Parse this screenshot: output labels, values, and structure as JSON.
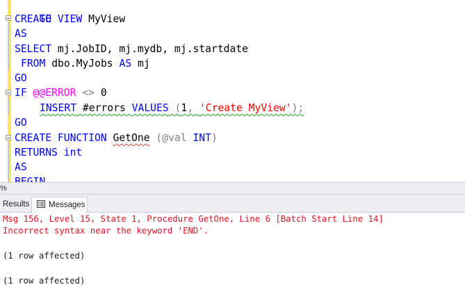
{
  "editor": {
    "lines": [
      {
        "t1": "GO"
      },
      {
        "t1": "CREATE VIEW",
        "t2": " MyView"
      },
      {
        "t1": "AS"
      },
      {
        "t1": "SELECT",
        "t2": " mj.JobID, mj.mydb, mj.startdate"
      },
      {
        "t1": "FROM",
        "t2": " dbo.MyJobs ",
        "t3": "AS",
        "t4": " mj"
      },
      {
        "t1": "GO"
      },
      {
        "t1": "IF",
        "t2": " @@ERROR",
        "t3": " <> ",
        "t4": "0"
      },
      {
        "t1": "INSERT",
        "t2": " #errors ",
        "t3": "VALUES",
        "t4": " (",
        "t5": "1",
        "t6": ", ",
        "t7": "'Create MyView'",
        "t8": ");"
      },
      {
        "t1": "GO"
      },
      {
        "t1": "CREATE FUNCTION",
        "t2": " ",
        "t3": "GetOne",
        "t4": " (@val ",
        "t5": "INT",
        "t6": ")"
      },
      {
        "t1": "RETURNS",
        "t2": " int"
      },
      {
        "t1": "AS"
      },
      {
        "t1": "BEGIN"
      }
    ]
  },
  "zoom": {
    "value": "%"
  },
  "tabs": {
    "results_label": "Results",
    "messages_label": "Messages",
    "messages_icon": "messages-icon"
  },
  "messages": [
    "Msg 156, Level 15, State 1, Procedure GetOne, Line 6 [Batch Start Line 14]",
    "Incorrect syntax near the keyword 'END'.",
    "(1 row affected)",
    "(1 row affected)"
  ],
  "colors": {
    "keyword": "#0000ff",
    "system_function": "#ff00ff",
    "operator": "#808080",
    "string": "#ff0000",
    "error_text": "#e81123",
    "change_margin": "#ffe84f"
  }
}
